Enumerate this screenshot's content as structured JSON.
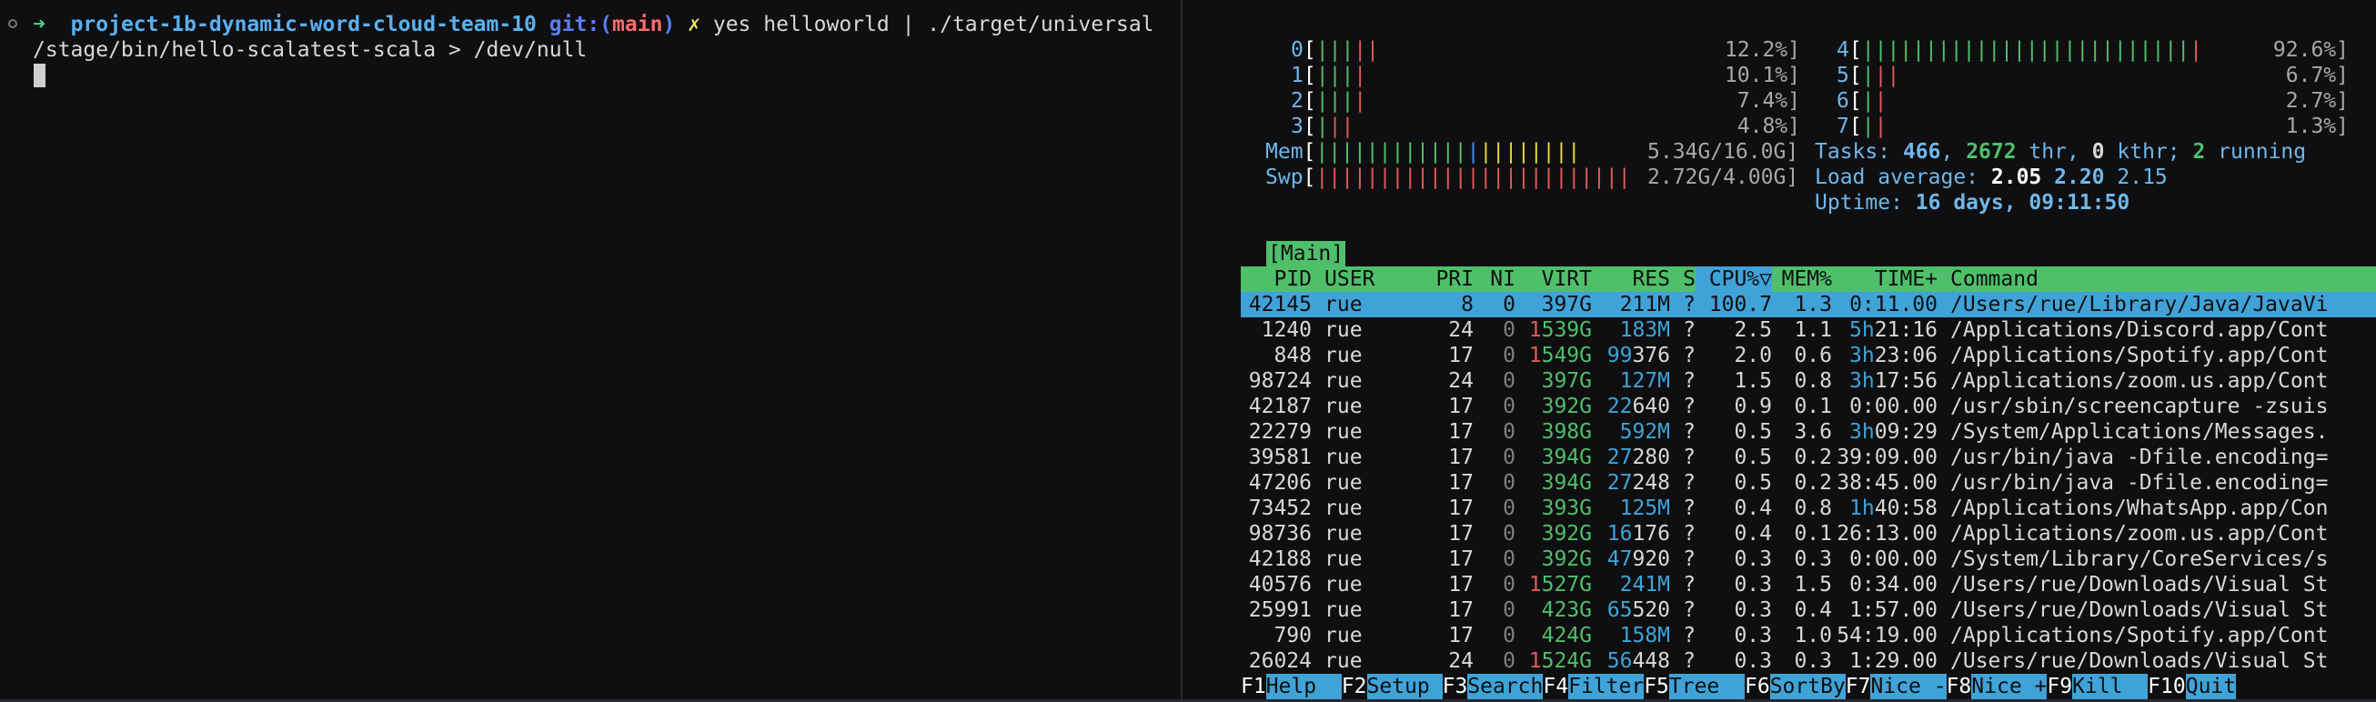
{
  "terminal_left": {
    "prompt_arrow": "➜",
    "project": "project-1b-dynamic-word-cloud-team-10",
    "git_prefix": "git:(",
    "branch": "main",
    "git_suffix": ")",
    "dirty_mark": "✗",
    "command_line1": "yes helloworld | ./target/universal",
    "command_line2": "/stage/bin/hello-scalatest-scala > /dev/null"
  },
  "htop": {
    "cpus": [
      {
        "id": "0",
        "bars": "|||||",
        "bar_colors": [
          "g",
          "g",
          "g",
          "r",
          "r"
        ],
        "pct": "12.2%]"
      },
      {
        "id": "1",
        "bars": "||||",
        "bar_colors": [
          "g",
          "g",
          "g",
          "r"
        ],
        "pct": "10.1%]"
      },
      {
        "id": "2",
        "bars": "||||",
        "bar_colors": [
          "g",
          "g",
          "g",
          "r"
        ],
        "pct": "7.4%]"
      },
      {
        "id": "3",
        "bars": "|||",
        "bar_colors": [
          "g",
          "r",
          "r"
        ],
        "pct": "4.8%]"
      },
      {
        "id": "4",
        "bars": "|||||||||||||||||||||||||||",
        "pct": "92.6%]"
      },
      {
        "id": "5",
        "bars": "|||",
        "bar_colors": [
          "g",
          "r",
          "r"
        ],
        "pct": "6.7%]"
      },
      {
        "id": "6",
        "bars": "||",
        "bar_colors": [
          "g",
          "r"
        ],
        "pct": "2.7%]"
      },
      {
        "id": "7",
        "bars": "||",
        "bar_colors": [
          "g",
          "r"
        ],
        "pct": "1.3%]"
      }
    ],
    "mem_label": "Mem",
    "mem_bars_green": "||||||||||||",
    "mem_bars_blue": "|",
    "mem_bars_yellow": "||||||||",
    "mem_value": "5.34G/16.0G]",
    "swp_label": "Swp",
    "swp_bars": "|||||||||||||||||||||||||",
    "swp_value": "2.72G/4.00G]",
    "tasks_label": "Tasks: ",
    "tasks_count": "466",
    "tasks_thr": "2672",
    "tasks_thr_label": " thr, ",
    "tasks_kthr": "0",
    "tasks_kthr_label": " kthr; ",
    "tasks_running": "2",
    "tasks_running_label": " running",
    "load_label": "Load average: ",
    "load_1": "2.05",
    "load_5": "2.20",
    "load_15": "2.15",
    "uptime_label": "Uptime: ",
    "uptime_value": "16 days, 09:11:50",
    "main_tab": "[Main]",
    "columns": {
      "pid": "PID",
      "user": "USER",
      "pri": "PRI",
      "ni": "NI",
      "virt": "VIRT",
      "res": "RES",
      "s": "S",
      "cpu": "CPU%▽",
      "mem": "MEM%",
      "time": "TIME+",
      "command": "Command"
    },
    "processes": [
      {
        "pid": "42145",
        "user": "rue",
        "pri": "8",
        "ni": "0",
        "virt": "397G",
        "res": "211M",
        "s": "?",
        "cpu": "100.7",
        "mem": "1.3",
        "time": "0:11.00",
        "command": "/Users/rue/Library/Java/JavaVi",
        "selected": true
      },
      {
        "pid": "1240",
        "user": "rue",
        "pri": "24",
        "ni": "0",
        "virt": "1539G",
        "res": "183M",
        "s": "?",
        "cpu": "2.5",
        "mem": "1.1",
        "time": "5h21:16",
        "command": "/Applications/Discord.app/Cont"
      },
      {
        "pid": "848",
        "user": "rue",
        "pri": "17",
        "ni": "0",
        "virt": "1549G",
        "res": "99376",
        "s": "?",
        "cpu": "2.0",
        "mem": "0.6",
        "time": "3h23:06",
        "command": "/Applications/Spotify.app/Cont"
      },
      {
        "pid": "98724",
        "user": "rue",
        "pri": "24",
        "ni": "0",
        "virt": "397G",
        "res": "127M",
        "s": "?",
        "cpu": "1.5",
        "mem": "0.8",
        "time": "3h17:56",
        "command": "/Applications/zoom.us.app/Cont"
      },
      {
        "pid": "42187",
        "user": "rue",
        "pri": "17",
        "ni": "0",
        "virt": "392G",
        "res": "22640",
        "s": "?",
        "cpu": "0.9",
        "mem": "0.1",
        "time": "0:00.00",
        "command": "/usr/sbin/screencapture -zsuis"
      },
      {
        "pid": "22279",
        "user": "rue",
        "pri": "17",
        "ni": "0",
        "virt": "398G",
        "res": "592M",
        "s": "?",
        "cpu": "0.5",
        "mem": "3.6",
        "time": "3h09:29",
        "command": "/System/Applications/Messages."
      },
      {
        "pid": "39581",
        "user": "rue",
        "pri": "17",
        "ni": "0",
        "virt": "394G",
        "res": "27280",
        "s": "?",
        "cpu": "0.5",
        "mem": "0.2",
        "time": "39:09.00",
        "command": "/usr/bin/java -Dfile.encoding="
      },
      {
        "pid": "47206",
        "user": "rue",
        "pri": "17",
        "ni": "0",
        "virt": "394G",
        "res": "27248",
        "s": "?",
        "cpu": "0.5",
        "mem": "0.2",
        "time": "38:45.00",
        "command": "/usr/bin/java -Dfile.encoding="
      },
      {
        "pid": "73452",
        "user": "rue",
        "pri": "17",
        "ni": "0",
        "virt": "393G",
        "res": "125M",
        "s": "?",
        "cpu": "0.4",
        "mem": "0.8",
        "time": "1h40:58",
        "command": "/Applications/WhatsApp.app/Con"
      },
      {
        "pid": "98736",
        "user": "rue",
        "pri": "17",
        "ni": "0",
        "virt": "392G",
        "res": "16176",
        "s": "?",
        "cpu": "0.4",
        "mem": "0.1",
        "time": "26:13.00",
        "command": "/Applications/zoom.us.app/Cont"
      },
      {
        "pid": "42188",
        "user": "rue",
        "pri": "17",
        "ni": "0",
        "virt": "392G",
        "res": "47920",
        "s": "?",
        "cpu": "0.3",
        "mem": "0.3",
        "time": "0:00.00",
        "command": "/System/Library/CoreServices/s"
      },
      {
        "pid": "40576",
        "user": "rue",
        "pri": "17",
        "ni": "0",
        "virt": "1527G",
        "res": "241M",
        "s": "?",
        "cpu": "0.3",
        "mem": "1.5",
        "time": "0:34.00",
        "command": "/Users/rue/Downloads/Visual St"
      },
      {
        "pid": "25991",
        "user": "rue",
        "pri": "17",
        "ni": "0",
        "virt": "423G",
        "res": "65520",
        "s": "?",
        "cpu": "0.3",
        "mem": "0.4",
        "time": "1:57.00",
        "command": "/Users/rue/Downloads/Visual St"
      },
      {
        "pid": "790",
        "user": "rue",
        "pri": "17",
        "ni": "0",
        "virt": "424G",
        "res": "158M",
        "s": "?",
        "cpu": "0.3",
        "mem": "1.0",
        "time": "54:19.00",
        "command": "/Applications/Spotify.app/Cont"
      },
      {
        "pid": "26024",
        "user": "rue",
        "pri": "24",
        "ni": "0",
        "virt": "1524G",
        "res": "56448",
        "s": "?",
        "cpu": "0.3",
        "mem": "0.3",
        "time": "1:29.00",
        "command": "/Users/rue/Downloads/Visual St"
      }
    ],
    "footer": [
      {
        "key": "F1",
        "label": "Help  "
      },
      {
        "key": "F2",
        "label": "Setup "
      },
      {
        "key": "F3",
        "label": "Search"
      },
      {
        "key": "F4",
        "label": "Filter"
      },
      {
        "key": "F5",
        "label": "Tree  "
      },
      {
        "key": "F6",
        "label": "SortBy"
      },
      {
        "key": "F7",
        "label": "Nice -"
      },
      {
        "key": "F8",
        "label": "Nice +"
      },
      {
        "key": "F9",
        "label": "Kill  "
      },
      {
        "key": "F10",
        "label": "Quit"
      }
    ]
  },
  "colors": {
    "background": "#0f0f11",
    "green": "#4fbf6a",
    "blue": "#3fa3d8",
    "red": "#e05a5a",
    "yellow": "#e6d93a"
  }
}
